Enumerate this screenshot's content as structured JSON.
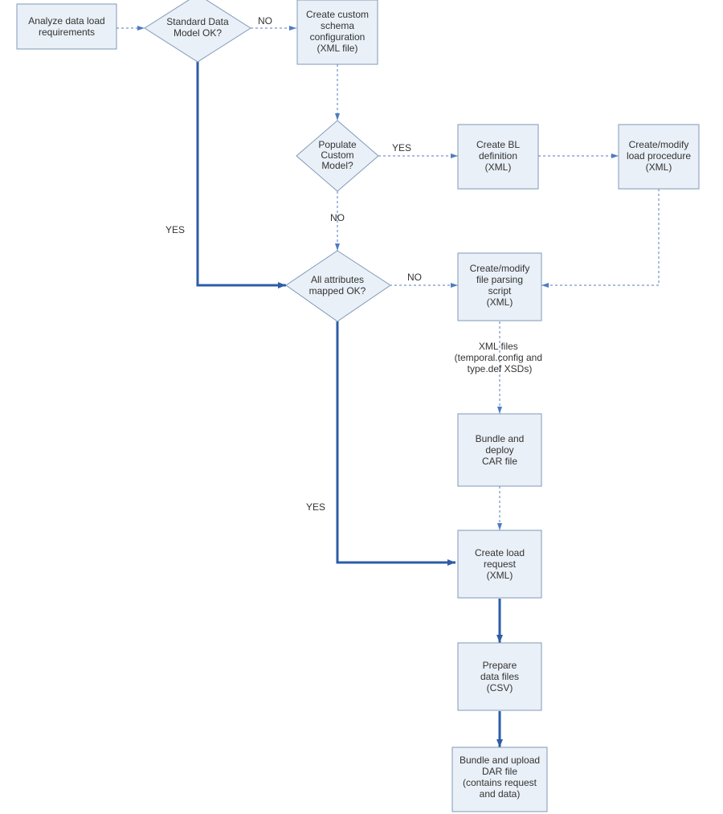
{
  "diagram": {
    "type": "flowchart",
    "nodes": {
      "analyze": {
        "kind": "process",
        "lines": [
          "Analyze data load",
          "requirements"
        ]
      },
      "standardOK": {
        "kind": "decision",
        "lines": [
          "Standard Data",
          "Model OK?"
        ]
      },
      "createSchema": {
        "kind": "process",
        "lines": [
          "Create custom",
          "schema",
          "configuration",
          "(XML file)"
        ]
      },
      "populate": {
        "kind": "decision",
        "lines": [
          "Populate",
          "Custom",
          "Model?"
        ]
      },
      "createBL": {
        "kind": "process",
        "lines": [
          "Create BL",
          "definition",
          "(XML)"
        ]
      },
      "modifyLoad": {
        "kind": "process",
        "lines": [
          "Create/modify",
          "load procedure",
          "(XML)"
        ]
      },
      "attributesOK": {
        "kind": "decision",
        "lines": [
          "All attributes",
          "mapped OK?"
        ]
      },
      "parseScript": {
        "kind": "process",
        "lines": [
          "Create/modify",
          "file parsing",
          "script",
          "(XML)"
        ]
      },
      "annotation": {
        "kind": "annotation",
        "lines": [
          "XML files",
          "(temporal.config and",
          "type.def XSDs)"
        ]
      },
      "bundleCAR": {
        "kind": "process",
        "lines": [
          "Bundle and",
          "deploy",
          "CAR file"
        ]
      },
      "createLoadReq": {
        "kind": "process",
        "lines": [
          "Create load",
          "request",
          "(XML)"
        ]
      },
      "prepareCSV": {
        "kind": "process",
        "lines": [
          "Prepare",
          "data files",
          "(CSV)"
        ]
      },
      "bundleDAR": {
        "kind": "process",
        "lines": [
          "Bundle and upload",
          "DAR file",
          "(contains request",
          "and data)"
        ]
      }
    },
    "edgeLabels": {
      "no1": "NO",
      "yes1": "YES",
      "yes2": "YES",
      "no2": "NO",
      "no3": "NO",
      "yes3": "YES"
    },
    "edges": [
      {
        "from": "analyze",
        "to": "standardOK",
        "style": "dotted"
      },
      {
        "from": "standardOK",
        "to": "createSchema",
        "label": "no1",
        "style": "dotted"
      },
      {
        "from": "standardOK",
        "to": "attributesOK",
        "label": "yes1",
        "style": "solid-thick",
        "path": "down-right"
      },
      {
        "from": "createSchema",
        "to": "populate",
        "style": "dotted"
      },
      {
        "from": "populate",
        "to": "createBL",
        "label": "yes2",
        "style": "dotted"
      },
      {
        "from": "createBL",
        "to": "modifyLoad",
        "style": "dotted"
      },
      {
        "from": "populate",
        "to": "attributesOK",
        "label": "no2",
        "style": "dotted"
      },
      {
        "from": "modifyLoad",
        "to": "parseScript",
        "style": "dotted",
        "path": "down-left"
      },
      {
        "from": "attributesOK",
        "to": "parseScript",
        "label": "no3",
        "style": "dotted"
      },
      {
        "from": "attributesOK",
        "to": "createLoadReq",
        "label": "yes3",
        "style": "solid-thick",
        "path": "down-right"
      },
      {
        "from": "parseScript",
        "to": "bundleCAR",
        "style": "dotted",
        "annotated": "annotation"
      },
      {
        "from": "bundleCAR",
        "to": "createLoadReq",
        "style": "dotted"
      },
      {
        "from": "createLoadReq",
        "to": "prepareCSV",
        "style": "solid-thick"
      },
      {
        "from": "prepareCSV",
        "to": "bundleDAR",
        "style": "solid-thick"
      }
    ]
  }
}
